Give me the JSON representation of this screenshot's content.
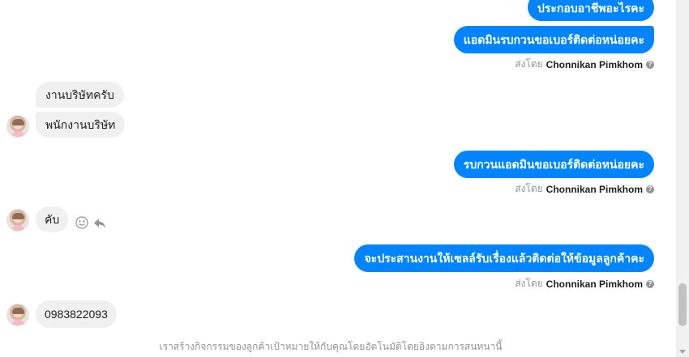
{
  "messages": {
    "out1": "ประกอบอาชีพอะไรคะ",
    "out2": "แอดมินรบกวนขอเบอร์ติดต่อหน่อยคะ",
    "in1": "งานบริษัทครับ",
    "in2": "พนักงานบริษัท",
    "out3": "รบกวนแอดมินขอเบอร์ติดต่อหน่อยคะ",
    "in3": "คับ",
    "out4": "จะประสานงานให้เซลล์รับเรื่องแล้วติดต่อให้ข้อมูลลูกค้าคะ",
    "in4": "0983822093"
  },
  "sent_by": {
    "prefix": "ส่งโดย",
    "name": "Chonnikan Pimkhom",
    "info_symbol": "?"
  },
  "footer_notice": "เราสร้างกิจกรรมของลูกค้าเป้าหมายให้กับคุณโดยอัตโนมัติโดยอิงตามการสนทนานี้",
  "colors": {
    "outgoing_bubble": "#0084ff",
    "incoming_bubble": "#f1f0f0",
    "meta_text": "#90949c"
  },
  "icons": {
    "avatar": "user-avatar-icon",
    "smile": "smile-icon",
    "reply": "reply-icon",
    "info": "info-icon"
  }
}
